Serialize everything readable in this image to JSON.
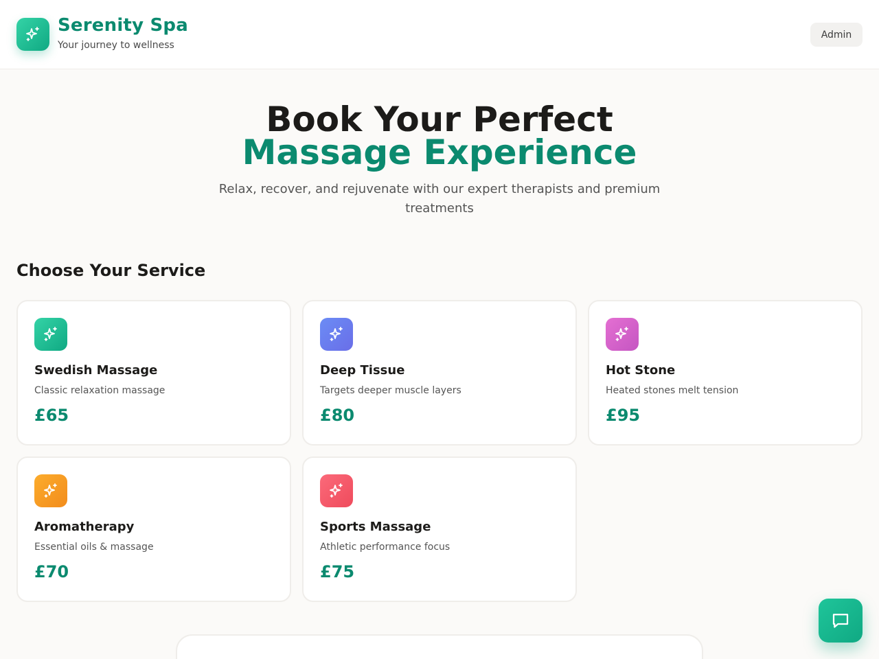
{
  "brand": {
    "name": "Serenity Spa",
    "tagline": "Your journey to wellness",
    "accent": "#0b8a6f"
  },
  "header": {
    "admin_label": "Admin"
  },
  "hero": {
    "title_line1": "Book Your Perfect",
    "title_line2": "Massage Experience",
    "subtitle": "Relax, recover, and rejuvenate with our expert therapists and premium treatments"
  },
  "services": {
    "heading": "Choose Your Service",
    "items": [
      {
        "name": "Swedish Massage",
        "description": "Classic relaxation massage",
        "price": "£65",
        "icon": "sparkles-icon",
        "color_from": "#34d3a6",
        "color_to": "#10a983"
      },
      {
        "name": "Deep Tissue",
        "description": "Targets deeper muscle layers",
        "price": "£80",
        "icon": "sparkles-icon",
        "color_from": "#6b8cf5",
        "color_to": "#6a6ee8"
      },
      {
        "name": "Hot Stone",
        "description": "Heated stones melt tension",
        "price": "£95",
        "icon": "sparkles-icon",
        "color_from": "#e46fd2",
        "color_to": "#c556c2"
      },
      {
        "name": "Aromatherapy",
        "description": "Essential oils & massage",
        "price": "£70",
        "icon": "sparkles-icon",
        "color_from": "#fcac2c",
        "color_to": "#f28c1c"
      },
      {
        "name": "Sports Massage",
        "description": "Athletic performance focus",
        "price": "£75",
        "icon": "sparkles-icon",
        "color_from": "#fb6a7a",
        "color_to": "#ef4b5c"
      }
    ]
  },
  "chat": {
    "icon": "chat-icon"
  }
}
